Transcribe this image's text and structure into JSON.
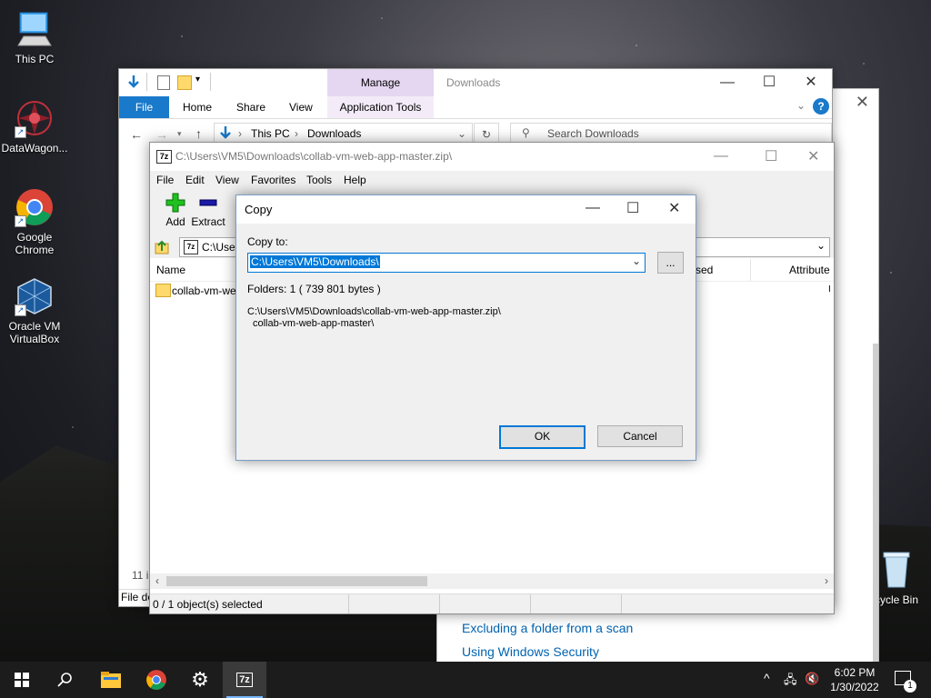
{
  "desktop": {
    "icons": [
      {
        "label": "This PC"
      },
      {
        "label": "DataWagon..."
      },
      {
        "label": "Google Chrome"
      },
      {
        "label": "Oracle VM VirtualBox"
      },
      {
        "label": "cycle Bin"
      }
    ]
  },
  "background_window": {
    "links": [
      "Excluding a folder from a scan",
      "Using Windows Security"
    ]
  },
  "explorer": {
    "title": "Downloads",
    "manage_tab": "Manage",
    "ribbon_tabs": [
      "File",
      "Home",
      "Share",
      "View"
    ],
    "app_tools_tab": "Application Tools",
    "breadcrumb": [
      "This PC",
      "Downloads"
    ],
    "search_placeholder": "Search Downloads",
    "item_count": "11 i",
    "status_left": "File de"
  },
  "zip": {
    "title": "C:\\Users\\VM5\\Downloads\\collab-vm-web-app-master.zip\\",
    "menu": [
      "File",
      "Edit",
      "View",
      "Favorites",
      "Tools",
      "Help"
    ],
    "toolbar": {
      "add": "Add",
      "extract": "Extract"
    },
    "path_value": "C:\\Users",
    "columns": {
      "name": "Name",
      "modified": "sed",
      "attributes": "Attribute"
    },
    "row_name": "collab-vm-we",
    "status": "0 / 1 object(s) selected"
  },
  "copy_dialog": {
    "title": "Copy",
    "copy_to_label": "Copy to:",
    "path_value": "C:\\Users\\VM5\\Downloads\\",
    "browse_label": "...",
    "folders_info": "Folders: 1    ( 739 801 bytes )",
    "source_line1": "C:\\Users\\VM5\\Downloads\\collab-vm-web-app-master.zip\\",
    "source_line2": "collab-vm-web-app-master\\",
    "ok_label": "OK",
    "cancel_label": "Cancel"
  },
  "taskbar": {
    "time": "6:02 PM",
    "date": "1/30/2022",
    "notification_count": "1",
    "zip_label": "7z"
  },
  "colors": {
    "accent": "#0078d7",
    "file_tab": "#1979ca",
    "manage_tab": "#e5d6f1",
    "taskbar": "#1c1c1c"
  }
}
